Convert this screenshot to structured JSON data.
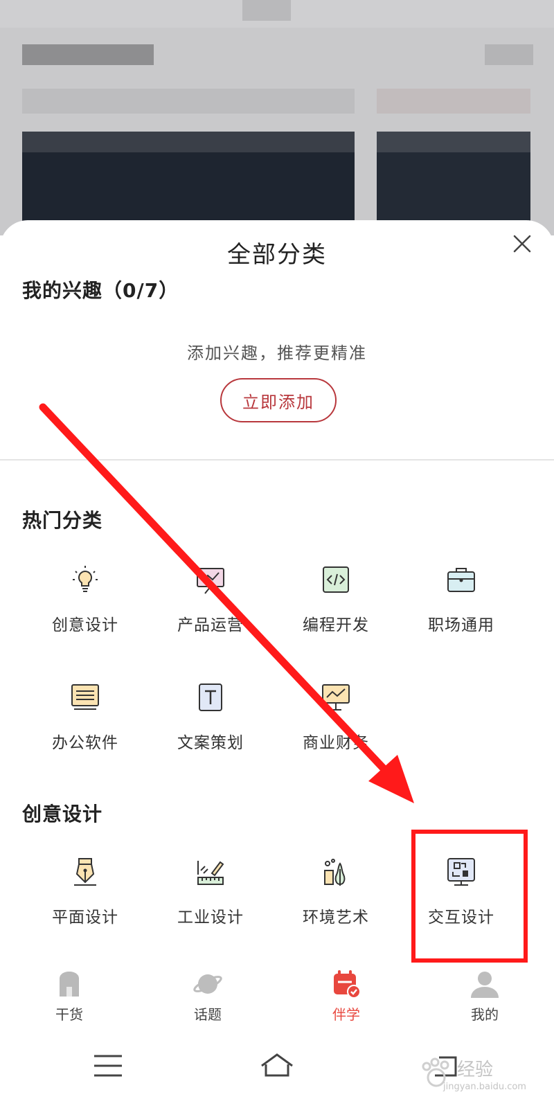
{
  "sheet": {
    "title": "全部分类",
    "close_icon": "close-icon"
  },
  "interests": {
    "title": "我的兴趣（0/7）",
    "hint": "添加兴趣，推荐更精准",
    "add_label": "立即添加"
  },
  "hot": {
    "title": "热门分类",
    "items": [
      {
        "label": "创意设计",
        "icon": "lightbulb-icon"
      },
      {
        "label": "产品运营",
        "icon": "presentation-icon"
      },
      {
        "label": "编程开发",
        "icon": "code-icon"
      },
      {
        "label": "职场通用",
        "icon": "briefcase-icon"
      },
      {
        "label": "办公软件",
        "icon": "office-icon"
      },
      {
        "label": "文案策划",
        "icon": "text-doc-icon"
      },
      {
        "label": "商业财务",
        "icon": "finance-board-icon"
      }
    ]
  },
  "creative": {
    "title": "创意设计",
    "items": [
      {
        "label": "平面设计",
        "icon": "pen-nib-icon"
      },
      {
        "label": "工业设计",
        "icon": "ruler-pencil-icon"
      },
      {
        "label": "环境艺术",
        "icon": "landscape-icon"
      },
      {
        "label": "交互设计",
        "icon": "monitor-interaction-icon"
      }
    ]
  },
  "bottom_nav": {
    "items": [
      {
        "label": "干货",
        "icon": "box-icon"
      },
      {
        "label": "话题",
        "icon": "planet-icon"
      },
      {
        "label": "伴学",
        "icon": "calendar-check-icon"
      },
      {
        "label": "我的",
        "icon": "user-icon"
      }
    ]
  },
  "watermark": {
    "main": "经验",
    "sub": "jingyan.baidu.com"
  },
  "colors": {
    "accent": "#b8373c",
    "active_nav": "#e8473e",
    "annotation": "#ff1a1a"
  }
}
